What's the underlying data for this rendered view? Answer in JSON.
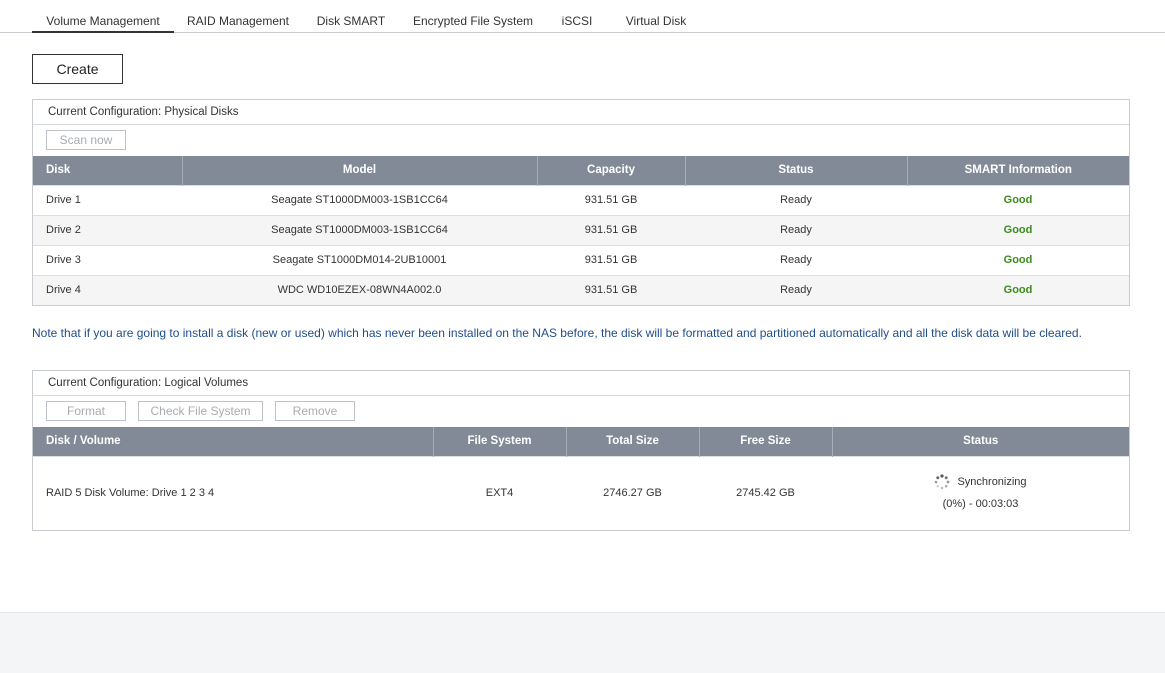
{
  "tabs": [
    {
      "label": "Volume Management",
      "active": true
    },
    {
      "label": "RAID Management",
      "active": false
    },
    {
      "label": "Disk SMART",
      "active": false
    },
    {
      "label": "Encrypted File System",
      "active": false
    },
    {
      "label": "iSCSI",
      "active": false
    },
    {
      "label": "Virtual Disk",
      "active": false
    }
  ],
  "create_label": "Create",
  "physical": {
    "title": "Current Configuration: Physical Disks",
    "scan_label": "Scan now",
    "headers": [
      "Disk",
      "Model",
      "Capacity",
      "Status",
      "SMART Information"
    ],
    "rows": [
      {
        "disk": "Drive 1",
        "model": "Seagate ST1000DM003-1SB1CC64",
        "capacity": "931.51 GB",
        "status": "Ready",
        "smart": "Good"
      },
      {
        "disk": "Drive 2",
        "model": "Seagate ST1000DM003-1SB1CC64",
        "capacity": "931.51 GB",
        "status": "Ready",
        "smart": "Good"
      },
      {
        "disk": "Drive 3",
        "model": "Seagate ST1000DM014-2UB10001",
        "capacity": "931.51 GB",
        "status": "Ready",
        "smart": "Good"
      },
      {
        "disk": "Drive 4",
        "model": "WDC WD10EZEX-08WN4A002.0",
        "capacity": "931.51 GB",
        "status": "Ready",
        "smart": "Good"
      }
    ]
  },
  "note": "Note that if you are going to install a disk (new or used) which has never been installed on the NAS before, the disk will be formatted and partitioned automatically and all the disk data will be cleared.",
  "logical": {
    "title": "Current Configuration: Logical Volumes",
    "format_label": "Format",
    "check_label": "Check File System",
    "remove_label": "Remove",
    "headers": [
      "Disk / Volume",
      "File System",
      "Total Size",
      "Free Size",
      "Status"
    ],
    "rows": [
      {
        "volume": "RAID 5 Disk Volume: Drive 1 2 3 4",
        "fs": "EXT4",
        "total": "2746.27 GB",
        "free": "2745.42 GB",
        "status": "Synchronizing",
        "progress": "(0%) - 00:03:03"
      }
    ]
  },
  "colors": {
    "header_bg": "#818a96",
    "good": "#3d8c1d",
    "note": "#1f4e8c"
  },
  "icons": {
    "status": "loading-spinner-icon"
  }
}
